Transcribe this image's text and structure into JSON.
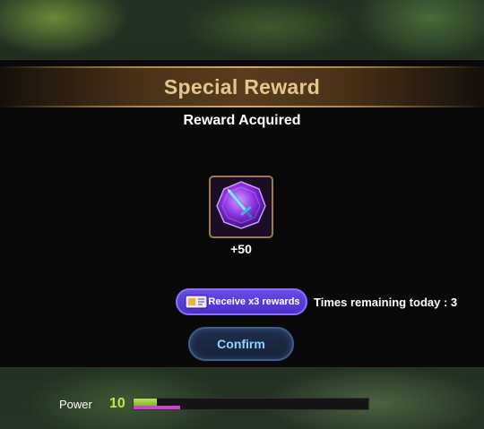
{
  "dialog": {
    "title": "Special Reward",
    "subtitle": "Reward Acquired"
  },
  "reward_item": {
    "icon": "purple-gem-sword-icon",
    "quantity": "+50"
  },
  "multiplier": {
    "button_label": "Receive x3 rewards",
    "times_remaining": "Times remaining today : 3"
  },
  "confirm": {
    "label": "Confirm"
  },
  "power": {
    "label": "Power",
    "value": "10",
    "xp_fraction": 0.1,
    "secondary_fraction": 0.2
  },
  "colors": {
    "title": "#e7c58e",
    "confirm_text": "#8fd4ff",
    "rewards_button": "#5a3ad8",
    "power_value": "#c7e24a",
    "power_green": "#9fd23a",
    "power_pink": "#d23fd8"
  }
}
